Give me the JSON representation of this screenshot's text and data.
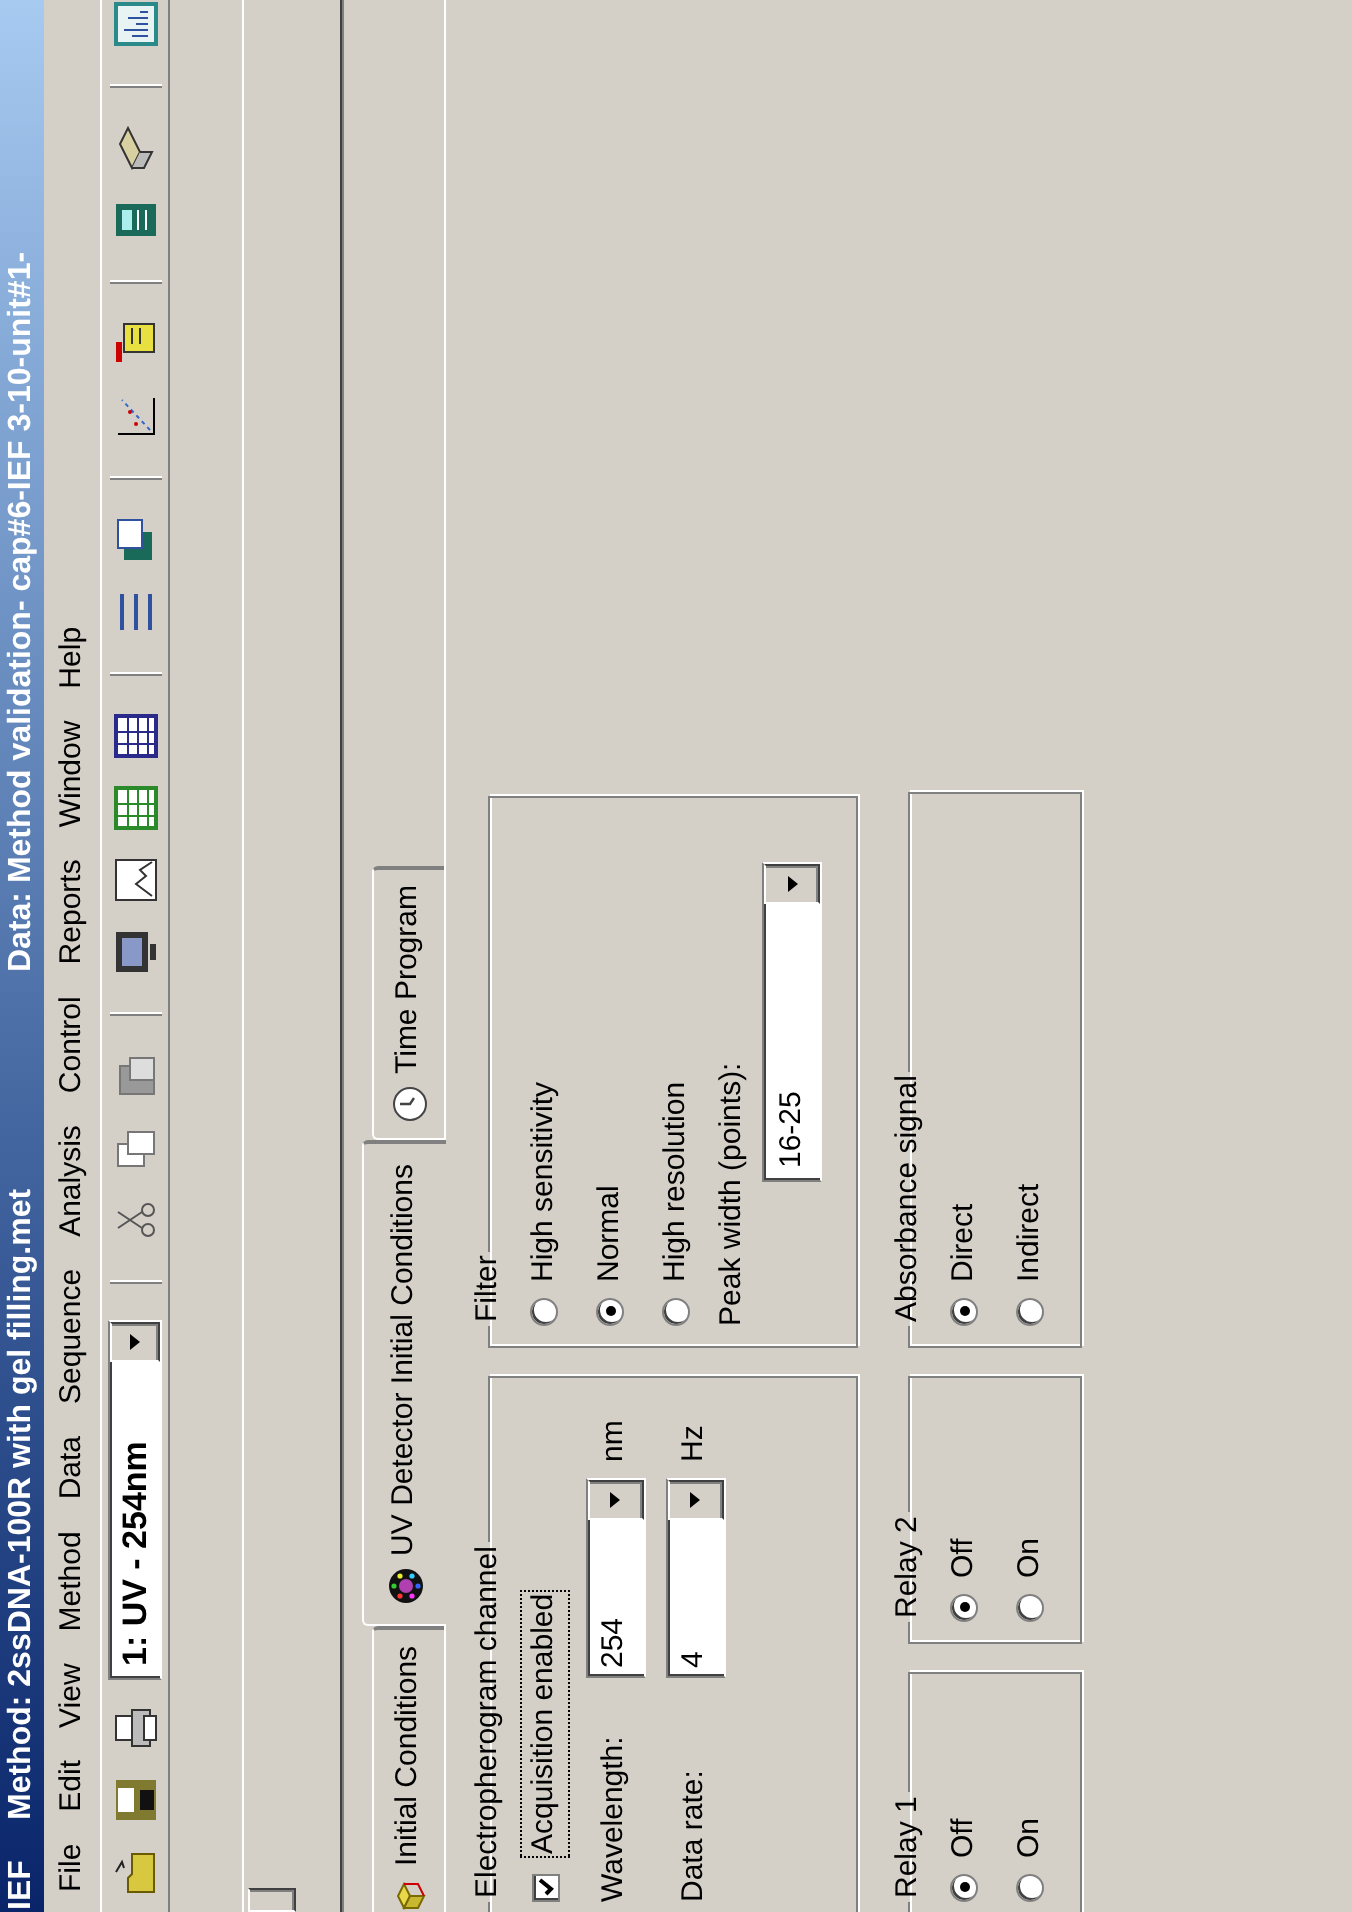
{
  "title_bar": {
    "app": "IEF",
    "method": "Method: 2ssDNA-100R with gel filling.met",
    "data": "Data: Method validation- cap#6-IEF 3-10-unit#1-"
  },
  "menu": [
    "File",
    "Edit",
    "View",
    "Method",
    "Data",
    "Sequence",
    "Analysis",
    "Control",
    "Reports",
    "Window",
    "Help"
  ],
  "toolbar": {
    "channel_select": {
      "value": "1: UV - 254nm"
    }
  },
  "tabs": [
    {
      "label": "Initial Conditions",
      "selected": false
    },
    {
      "label": "UV Detector Initial Conditions",
      "selected": true
    },
    {
      "label": "Time Program",
      "selected": false
    }
  ],
  "electropherogram_channel": {
    "label": "Electropherogram channel",
    "acquisition": {
      "label": "Acquisition enabled",
      "checked": true
    },
    "wavelength": {
      "label": "Wavelength:",
      "value": "254",
      "unit": "nm"
    },
    "data_rate": {
      "label": "Data rate:",
      "value": "4",
      "unit": "Hz"
    }
  },
  "filter": {
    "label": "Filter",
    "options": [
      {
        "label": "High sensitivity",
        "selected": false
      },
      {
        "label": "Normal",
        "selected": true
      },
      {
        "label": "High resolution",
        "selected": false
      }
    ],
    "peak_width": {
      "label": "Peak width (points):",
      "value": "16-25"
    }
  },
  "relay_1": {
    "label": "Relay 1",
    "options": [
      {
        "label": "Off",
        "selected": true
      },
      {
        "label": "On",
        "selected": false
      }
    ]
  },
  "relay_2": {
    "label": "Relay 2",
    "options": [
      {
        "label": "Off",
        "selected": true
      },
      {
        "label": "On",
        "selected": false
      }
    ]
  },
  "absorbance_signal": {
    "label": "Absorbance signal",
    "options": [
      {
        "label": "Direct",
        "selected": true
      },
      {
        "label": "Indirect",
        "selected": false
      }
    ]
  }
}
